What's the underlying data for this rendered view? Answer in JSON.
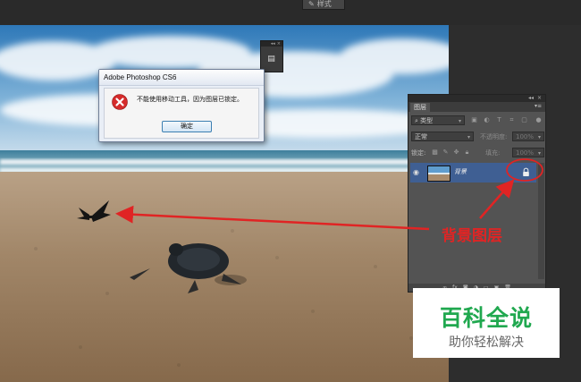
{
  "toolbar": {
    "chip_label": "样式"
  },
  "dialog": {
    "title": "Adobe Photoshop CS6",
    "message": "不能使用移动工具，因为图层已锁定。",
    "ok_label": "确定",
    "icon": "error-x-icon"
  },
  "layers_panel": {
    "tab": "图层",
    "filter_kind": "类型",
    "blend_mode": "正常",
    "opacity_label": "不透明度:",
    "opacity_value": "100%",
    "lock_label": "锁定:",
    "fill_label": "填充:",
    "fill_value": "100%",
    "layers": [
      {
        "name": "背景",
        "visible": true,
        "locked": true
      }
    ]
  },
  "annotation": {
    "label": "背景图层",
    "color": "#e02424"
  },
  "watermark": {
    "title": "百科全说",
    "subtitle": "助你轻松解决",
    "color": "#20a84f"
  }
}
